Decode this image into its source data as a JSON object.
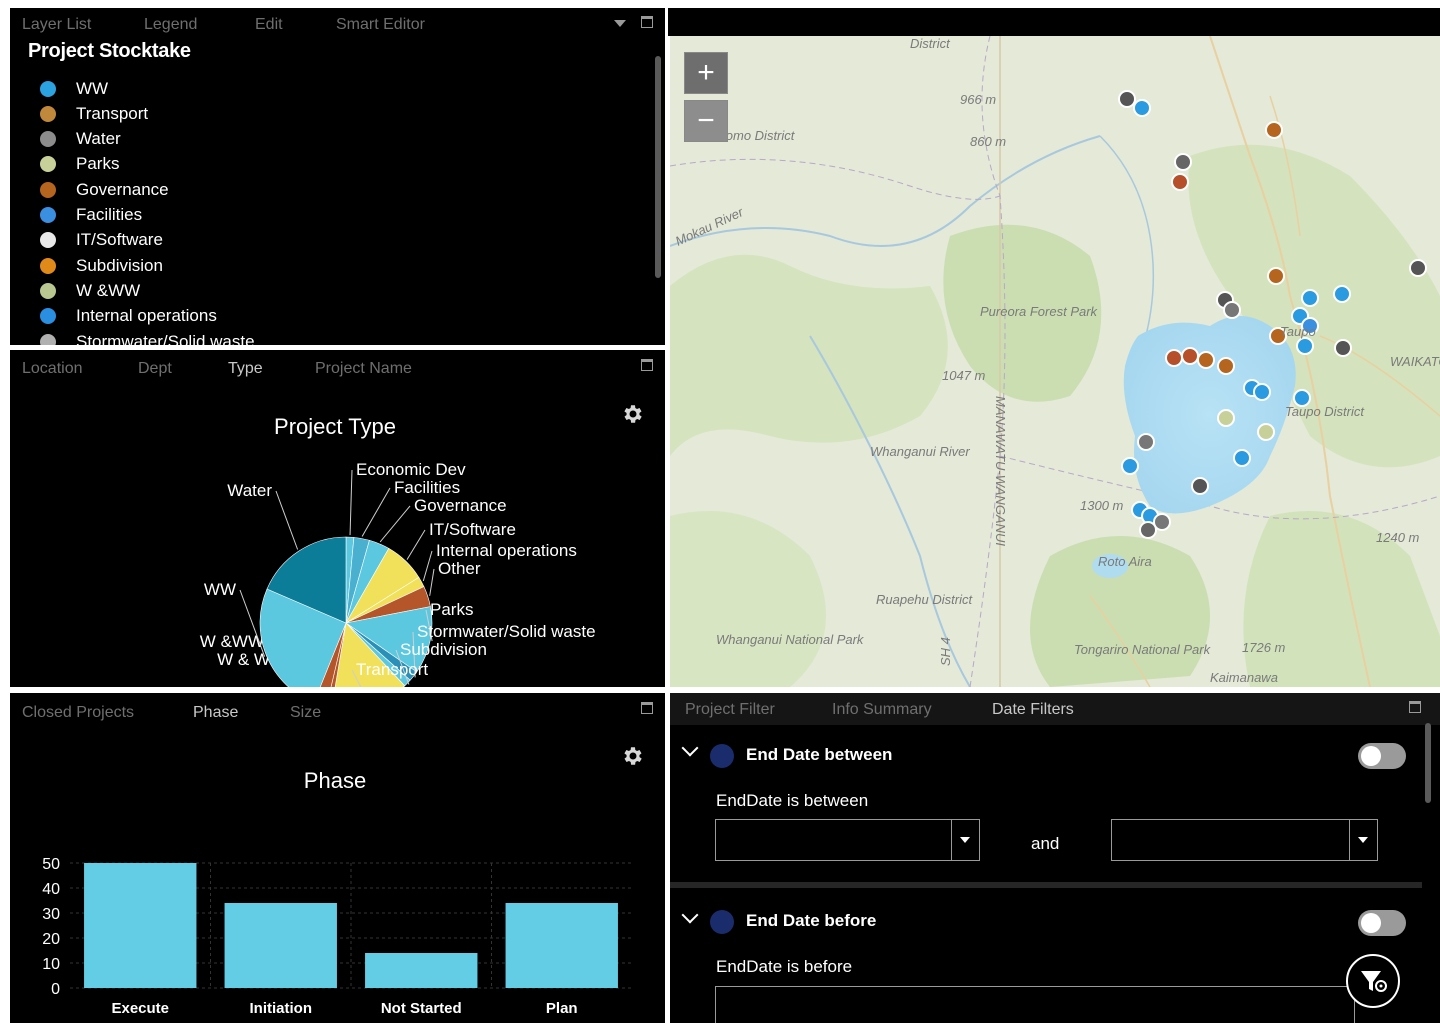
{
  "layer_panel": {
    "tabs": [
      "Layer List",
      "Legend",
      "Edit",
      "Smart Editor"
    ],
    "title": "Project Stocktake",
    "items": [
      {
        "label": "WW",
        "icon": "ww-icon",
        "color": "#2aa3e0"
      },
      {
        "label": "Transport",
        "icon": "transport-icon",
        "color": "#c0883a"
      },
      {
        "label": "Water",
        "icon": "water-icon",
        "color": "#8c8c8c"
      },
      {
        "label": "Parks",
        "icon": "parks-icon",
        "color": "#c8d09a"
      },
      {
        "label": "Governance",
        "icon": "governance-icon",
        "color": "#b5651d"
      },
      {
        "label": "Facilities",
        "icon": "facilities-icon",
        "color": "#3a8fe0"
      },
      {
        "label": "IT/Software",
        "icon": "cloud-icon",
        "color": "#e8e8e8"
      },
      {
        "label": "Subdivision",
        "icon": "subdivision-icon",
        "color": "#e08a1a"
      },
      {
        "label": "W &WW",
        "icon": "w-ww-icon",
        "color": "#b8c890"
      },
      {
        "label": "Internal operations",
        "icon": "internal-ops-icon",
        "color": "#2a8fe0"
      },
      {
        "label": "Stormwater/Solid waste",
        "icon": "stormwater-icon",
        "color": "#b0b0b0"
      }
    ]
  },
  "type_panel": {
    "tabs": [
      "Location",
      "Dept",
      "Type",
      "Project Name"
    ],
    "active_tab": "Type",
    "chart_data": {
      "type": "pie",
      "title": "Project Type",
      "slices": [
        {
          "label": "Economic Dev",
          "value": 1.5,
          "color": "#5bc8e0"
        },
        {
          "label": "Facilities",
          "value": 3,
          "color": "#4ab0d0"
        },
        {
          "label": "Governance",
          "value": 4,
          "color": "#5bc8e0"
        },
        {
          "label": "IT/Software",
          "value": 8,
          "color": "#f0e05a"
        },
        {
          "label": "Internal operations",
          "value": 2,
          "color": "#f0e05a"
        },
        {
          "label": "Other",
          "value": 4,
          "color": "#b5562a"
        },
        {
          "label": "Parks",
          "value": 13,
          "color": "#5bc8e0"
        },
        {
          "label": "Stormwater/Solid waste",
          "value": 2,
          "color": "#2a90b8"
        },
        {
          "label": "Subdivision",
          "value": 1.5,
          "color": "#5bc8e0"
        },
        {
          "label": "Transport",
          "value": 15,
          "color": "#f0e05a"
        },
        {
          "label": "W & WW",
          "value": 1,
          "color": "#b5562a"
        },
        {
          "label": "W &WW",
          "value": 2.5,
          "color": "#b5562a"
        },
        {
          "label": "WW",
          "value": 26,
          "color": "#5bc8e0"
        },
        {
          "label": "Water",
          "value": 19,
          "color": "#0b7d99"
        }
      ]
    }
  },
  "phase_panel": {
    "tabs": [
      "Closed Projects",
      "Phase",
      "Size"
    ],
    "active_tab": "Phase",
    "chart_data": {
      "type": "bar",
      "title": "Phase",
      "categories": [
        "Execute",
        "Initiation",
        "Not Started",
        "Plan"
      ],
      "values": [
        50,
        34,
        14,
        34
      ],
      "ylim": [
        0,
        50
      ],
      "yticks": [
        0,
        10,
        20,
        30,
        40,
        50
      ],
      "color": "#64cde6",
      "grid": true
    }
  },
  "map": {
    "zoom_in": "+",
    "zoom_out": "−",
    "labels": [
      "District",
      "966 m",
      "860 m",
      "Waitomo District",
      "Mokau River",
      "Pureora Forest Park",
      "1047 m",
      "MANAWATU-WANGANUI",
      "Taupo District",
      "WAIKATO",
      "Whanganui River",
      "1300 m",
      "1240 m",
      "Ruapehu District",
      "Roto Aira",
      "Whanganui National Park",
      "Tongariro National Park",
      "1726 m",
      "Kaimanawa",
      "SH 4",
      "Taupo"
    ]
  },
  "filter_panel": {
    "tabs": [
      "Project Filter",
      "Info Summary",
      "Date Filters"
    ],
    "active_tab": "Date Filters",
    "filters": [
      {
        "title": "End Date between",
        "label": "EndDate is between",
        "connector": "and"
      },
      {
        "title": "End Date before",
        "label": "EndDate is before"
      }
    ]
  }
}
